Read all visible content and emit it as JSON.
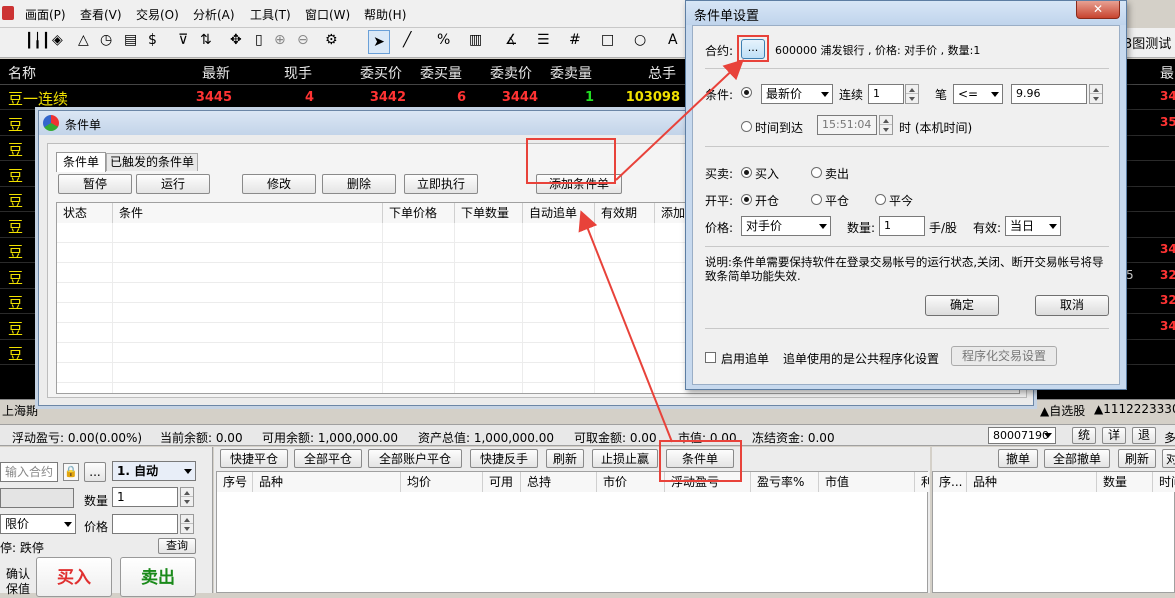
{
  "menu": [
    "画面(P)",
    "查看(V)",
    "交易(O)",
    "分析(A)",
    "工具(T)",
    "窗口(W)",
    "帮助(H)"
  ],
  "toolbar": {
    "a_label": "A",
    "right_text": "3图测试"
  },
  "quote": {
    "headers": [
      "名称",
      "最新",
      "现手",
      "委买价",
      "委买量",
      "委卖价",
      "委卖量",
      "总手"
    ],
    "first_row": {
      "name": "豆一连续",
      "last": "3445",
      "vol": "4",
      "bid": "3442",
      "bidvol": "6",
      "ask": "3444",
      "askvol": "1",
      "total": "103098"
    },
    "row_names": [
      "豆",
      "豆",
      "豆",
      "豆",
      "豆",
      "豆",
      "豆",
      "豆",
      "豆",
      "豆",
      "豆"
    ],
    "right_header": "最",
    "right_values": [
      "34",
      "35",
      "",
      "",
      "",
      "",
      "34",
      "32",
      "32",
      "34",
      ""
    ],
    "right_mid": [
      "",
      "",
      "",
      "",
      "",
      "",
      "",
      "5",
      "",
      "",
      ""
    ],
    "bottom_left": "上海期",
    "bottom_right": [
      "▲自选股",
      "▲11122233300"
    ]
  },
  "cond_window": {
    "title": "条件单",
    "tabs": [
      "条件单",
      "已触发的条件单"
    ],
    "buttons": [
      "暂停",
      "运行",
      "修改",
      "删除",
      "立即执行",
      "添加条件单"
    ],
    "columns": [
      "状态",
      "条件",
      "下单价格",
      "下单数量",
      "自动追单",
      "有效期",
      "添加时"
    ]
  },
  "dialog": {
    "title": "条件单设置",
    "contract_label": "合约:",
    "contract_btn": "...",
    "contract_info": "600000 浦发银行 , 价格: 对手价 , 数量:1",
    "condition_label": "条件:",
    "price_type": "最新价",
    "consecutive_label": "连续",
    "consecutive_value": "1",
    "count_label": "笔",
    "operator": "<=",
    "price_value": "9.96",
    "time_label": "时间到达",
    "time_value": "15:51:04",
    "time_suffix": "时 (本机时间)",
    "buysell_label": "买卖:",
    "buy": "买入",
    "sell": "卖出",
    "kaiping_label": "开平:",
    "open": "开仓",
    "close": "平仓",
    "close_today": "平今",
    "price_label": "价格:",
    "price_select": "对手价",
    "qty_label": "数量:",
    "qty_value": "1",
    "qty_unit": "手/股",
    "valid_label": "有效:",
    "valid_value": "当日",
    "note": "说明:条件单需要保持软件在登录交易帐号的运行状态,关闭、断开交易帐号将导致条简单功能失效.",
    "ok": "确定",
    "cancel": "取消",
    "follow_chk": "启用追单",
    "follow_text": "追单使用的是公共程序化设置",
    "prog_btn": "程序化交易设置"
  },
  "account": {
    "items": [
      "浮动盈亏: 0.00(0.00%)",
      "当前余额: 0.00",
      "可用余额: 1,000,000.00",
      "资产总值: 1,000,000.00",
      "可取金额: 0.00",
      "市值: 0.00",
      "冻结资金: 0.00"
    ],
    "account_no": "80007190",
    "btns": [
      "统",
      "详",
      "退"
    ],
    "more": "多"
  },
  "order": {
    "contract_placeholder": "输入合约",
    "mode": "1. 自动",
    "qty_label": "数量",
    "qty_value": "1",
    "price_type": "限价",
    "price_label": "价格",
    "limit_text": "停:  跌停",
    "query": "查询",
    "confirm1": "确认",
    "confirm2": "保值",
    "buy_btn": "买入",
    "sell_btn": "卖出"
  },
  "positions": {
    "buttons": [
      "快捷平仓",
      "全部平仓",
      "全部账户平仓",
      "快捷反手",
      "刷新",
      "止损止赢",
      "条件单"
    ],
    "columns": [
      "序号",
      "品种",
      "均价",
      "可用",
      "总持",
      "市价",
      "浮动盈亏",
      "盈亏率%",
      "市值",
      "利"
    ]
  },
  "orders_panel": {
    "buttons": [
      "撤单",
      "全部撤单",
      "刷新",
      "对"
    ],
    "columns": [
      "序...",
      "品种",
      "数量",
      "时间"
    ]
  }
}
